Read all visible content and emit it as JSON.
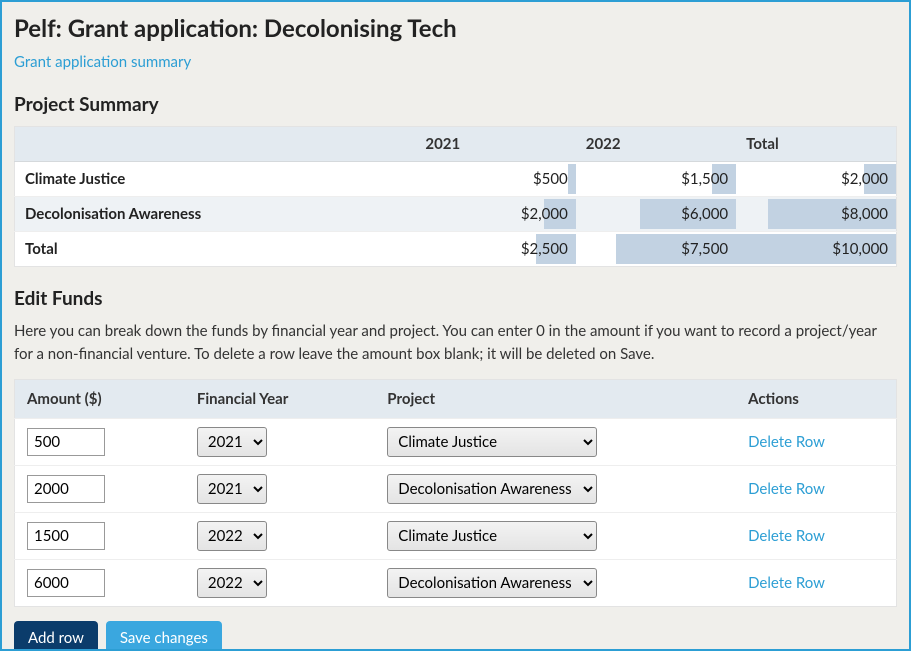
{
  "header": {
    "title": "Pelf: Grant application: Decolonising Tech",
    "summary_link": "Grant application summary"
  },
  "project_summary": {
    "heading": "Project Summary",
    "year_cols": [
      "2021",
      "2022"
    ],
    "total_col": "Total",
    "rows": [
      {
        "label": "Climate Justice",
        "y2021": "$500",
        "y2022": "$1,500",
        "total": "$2,000"
      },
      {
        "label": "Decolonisation Awareness",
        "y2021": "$2,000",
        "y2022": "$6,000",
        "total": "$8,000"
      },
      {
        "label": "Total",
        "y2021": "$2,500",
        "y2022": "$7,500",
        "total": "$10,000"
      }
    ]
  },
  "edit_funds": {
    "heading": "Edit Funds",
    "help": "Here you can break down the funds by financial year and project. You can enter 0 in the amount if you want to record a project/year for a non-financial venture. To delete a row leave the amount box blank; it will be deleted on Save.",
    "columns": {
      "amount": "Amount ($)",
      "fy": "Financial Year",
      "project": "Project",
      "actions": "Actions"
    },
    "delete_label": "Delete Row",
    "rows": [
      {
        "amount": "500",
        "fy": "2021",
        "project": "Climate Justice"
      },
      {
        "amount": "2000",
        "fy": "2021",
        "project": "Decolonisation Awareness"
      },
      {
        "amount": "1500",
        "fy": "2022",
        "project": "Climate Justice"
      },
      {
        "amount": "6000",
        "fy": "2022",
        "project": "Decolonisation Awareness"
      }
    ],
    "buttons": {
      "add": "Add row",
      "save": "Save changes"
    }
  },
  "chart_data": {
    "type": "table",
    "title": "Project Summary",
    "columns": [
      "2021",
      "2022",
      "Total"
    ],
    "rows": [
      {
        "label": "Climate Justice",
        "values": [
          500,
          1500,
          2000
        ]
      },
      {
        "label": "Decolonisation Awareness",
        "values": [
          2000,
          6000,
          8000
        ]
      },
      {
        "label": "Total",
        "values": [
          2500,
          7500,
          10000
        ]
      }
    ],
    "max_value": 10000,
    "unit": "$"
  }
}
